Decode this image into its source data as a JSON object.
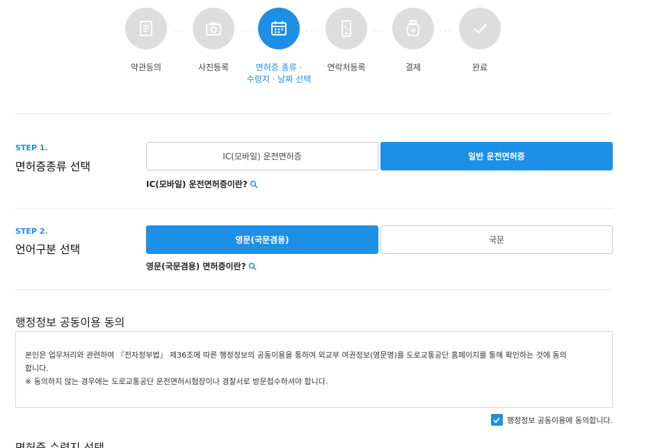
{
  "steps": [
    {
      "label": "약관동의",
      "icon": "document-icon"
    },
    {
      "label": "사진등록",
      "icon": "camera-icon"
    },
    {
      "label": "면허증 종류 ·",
      "label2": "수령지 · 날짜 선택",
      "icon": "calendar-icon"
    },
    {
      "label": "연락처등록",
      "icon": "phone-icon"
    },
    {
      "label": "결제",
      "icon": "money-bag-icon"
    },
    {
      "label": "완료",
      "icon": "check-icon"
    }
  ],
  "active_step": 2,
  "step1": {
    "tag": "STEP 1.",
    "title": "면허증종류 선택",
    "option_a": "IC(모바일) 운전면허증",
    "option_b": "일반 운전면허증",
    "selected": "option_b",
    "help": "IC(모바일) 운전면허증이란?"
  },
  "step2": {
    "tag": "STEP 2.",
    "title": "언어구분 선택",
    "option_a": "영문(국문겸용)",
    "option_b": "국문",
    "selected": "option_a",
    "help": "영문(국문겸용) 면허증이란?"
  },
  "admin": {
    "title": "행정정보 공동이용 동의",
    "line1": "본인은 업무처리와 관련하여 『전자정부법』 제36조에 따른 행정정보의 공동이용을 통하여 외교부 여권정보(영문명)를 도로교통공단 홈페이지를 통해 확인하는 것에 동의",
    "line2": "합니다.",
    "line3": "※ 동의하지 않는 경우에는 도로교통공단 운전면허시험장이나 경찰서로 방문접수하셔야 합니다.",
    "consent": "행정정보 공동이용에 동의합니다.",
    "checked": true
  },
  "next_section_title": "면허증 수령지 선택",
  "colors": {
    "accent": "#1d8fe4",
    "inactive_step": "#dddddd"
  }
}
